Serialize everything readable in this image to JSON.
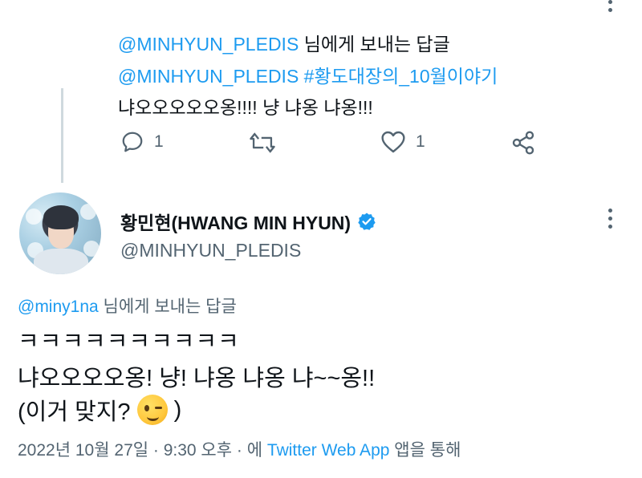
{
  "top_reply": {
    "replying_handle": "@MINHYUN_PLEDIS",
    "replying_suffix": "님에게 보내는 답글",
    "mention_hashtag": "@MINHYUN_PLEDIS #황도대장의_10월이야기",
    "text": "냐오오오오오옹!!!! 냥 냐옹 냐옹!!!",
    "reply_count": "1",
    "like_count": "1"
  },
  "main_tweet": {
    "display_name": "황민현(HWANG MIN HYUN)",
    "handle": "@MINHYUN_PLEDIS",
    "replying_handle": "@miny1na",
    "replying_suffix": "님에게 보내는 답글",
    "text_line1": "ㅋㅋㅋㅋㅋㅋㅋㅋㅋㅋ",
    "text_line2": "냐오오오오옹! 냥! 냐옹 냐옹 냐~~옹!!",
    "text_line3": "(이거 맞지?",
    "text_line3_end": ")",
    "timestamp": "2022년 10월 27일 · 9:30 오후 · 에",
    "source": "Twitter Web App",
    "source_suffix": "앱을 통해"
  },
  "icons": {
    "reply": "reply-icon",
    "retweet": "retweet-icon",
    "like": "heart-icon",
    "share": "share-icon",
    "verified": "verified-badge-icon",
    "more": "more-icon",
    "emoji": "winking-face-emoji"
  },
  "colors": {
    "accent": "#1d9bf0",
    "text": "#0f1419",
    "secondary": "#536471"
  }
}
